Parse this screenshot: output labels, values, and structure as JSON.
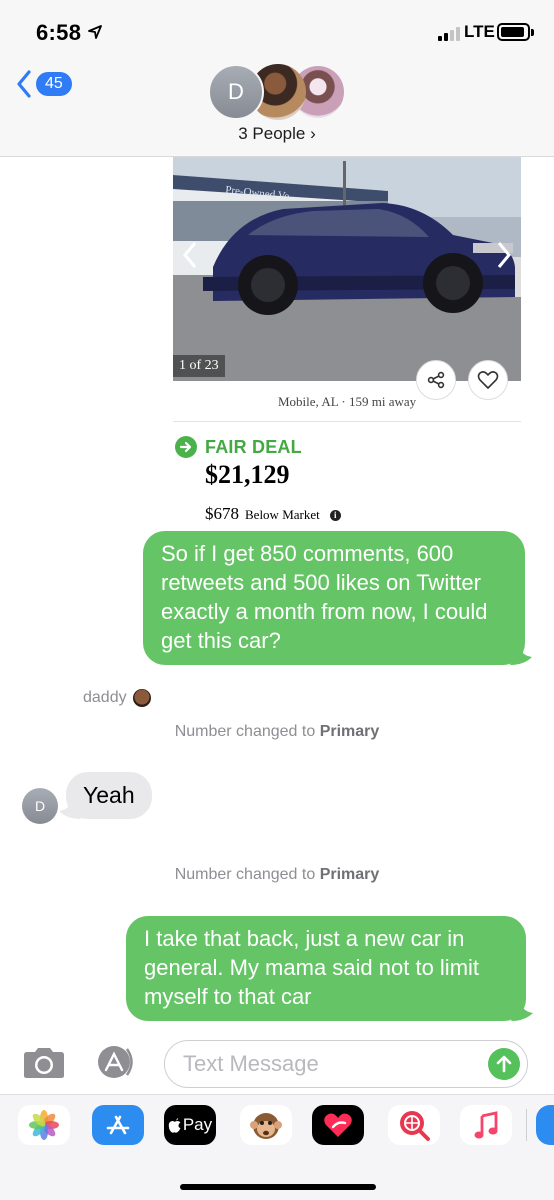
{
  "status_bar": {
    "time": "6:58",
    "network": "LTE"
  },
  "header": {
    "back_badge": "45",
    "avatar_initial": "D",
    "people_label": "3 People ›"
  },
  "listing": {
    "photo_counter": "1 of 23",
    "photo_sign": "Pre-Owned Ve",
    "location": "Mobile, AL · 159 mi away",
    "deal_label": "FAIR DEAL",
    "price": "$21,129",
    "below_amount": "$678",
    "below_text": "Below Market"
  },
  "messages": {
    "outgoing_1": "So if I get 850 comments, 600 retweets and 500 likes on Twitter exactly a month from now, I could get this car?",
    "sender_name": "daddy",
    "system_1_prefix": "Number changed to ",
    "system_1_bold": "Primary",
    "incoming_1": "Yeah",
    "incoming_avatar": "D",
    "system_2_prefix": "Number changed to ",
    "system_2_bold": "Primary",
    "outgoing_2": "I take that back, just a new car in general. My mama said not to limit myself to that car"
  },
  "input": {
    "placeholder": "Text Message",
    "value": ""
  },
  "app_drawer": {
    "apps": [
      "photos-icon",
      "app-store-icon",
      "apple-pay-icon",
      "animoji-icon",
      "digital-touch-icon",
      "web-images-icon",
      "music-icon"
    ],
    "apple_pay_label": "Pay"
  },
  "colors": {
    "outgoing_bubble": "#65c466",
    "incoming_bubble": "#e9e9eb",
    "badge": "#2f7cf6",
    "deal_green": "#44a843"
  }
}
